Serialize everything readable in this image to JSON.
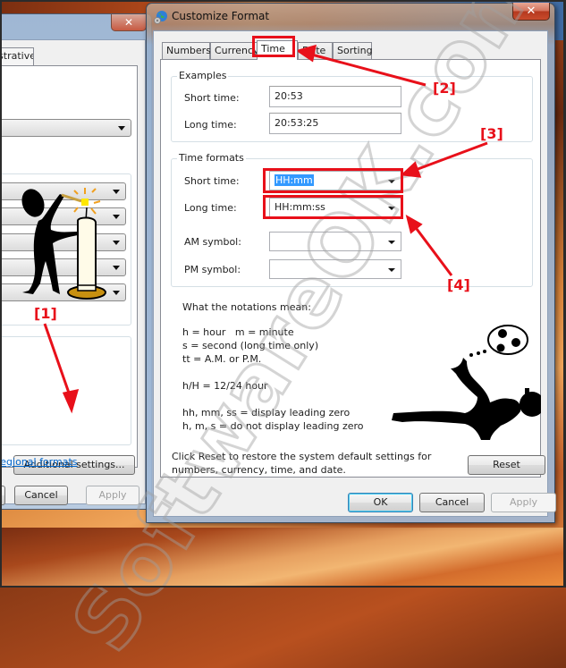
{
  "background_window": {
    "tab_label": "istrative",
    "additional_settings_label": "Additional settings...",
    "link_label": "regional formats",
    "cancel_label": "Cancel",
    "apply_label": "Apply",
    "close_glyph": "✕"
  },
  "dialog": {
    "title": "Customize Format",
    "close_glyph": "✕",
    "tabs": [
      {
        "label": "Numbers",
        "active": false
      },
      {
        "label": "Currency",
        "active": false
      },
      {
        "label": "Time",
        "active": true
      },
      {
        "label": "Date",
        "active": false
      },
      {
        "label": "Sorting",
        "active": false
      }
    ],
    "examples": {
      "group_label": "Examples",
      "short_time_label": "Short time:",
      "short_time_value": "20:53",
      "long_time_label": "Long time:",
      "long_time_value": "20:53:25"
    },
    "time_formats": {
      "group_label": "Time formats",
      "short_time_label": "Short time:",
      "short_time_value": "HH:mm",
      "long_time_label": "Long time:",
      "long_time_value": "HH:mm:ss",
      "am_symbol_label": "AM symbol:",
      "am_symbol_value": "",
      "pm_symbol_label": "PM symbol:",
      "pm_symbol_value": ""
    },
    "notations": {
      "heading": "What the notations mean:",
      "line1": "h = hour   m = minute",
      "line2": "s = second (long time only)",
      "line3": "tt = A.M. or P.M.",
      "line4": "h/H = 12/24 hour",
      "line5": "hh, mm, ss = display leading zero",
      "line6": "h, m, s = do not display leading zero"
    },
    "reset_text_line1": "Click Reset to restore the system default settings for",
    "reset_text_line2": "numbers, currency, time, and date.",
    "reset_label": "Reset",
    "ok_label": "OK",
    "cancel_label": "Cancel",
    "apply_label": "Apply"
  },
  "annotations": {
    "callout_1": "[1]",
    "callout_2": "[2]",
    "callout_3": "[3]",
    "callout_4": "[4]",
    "color": "#e8101a"
  },
  "watermark": "SoftwareOK.com"
}
